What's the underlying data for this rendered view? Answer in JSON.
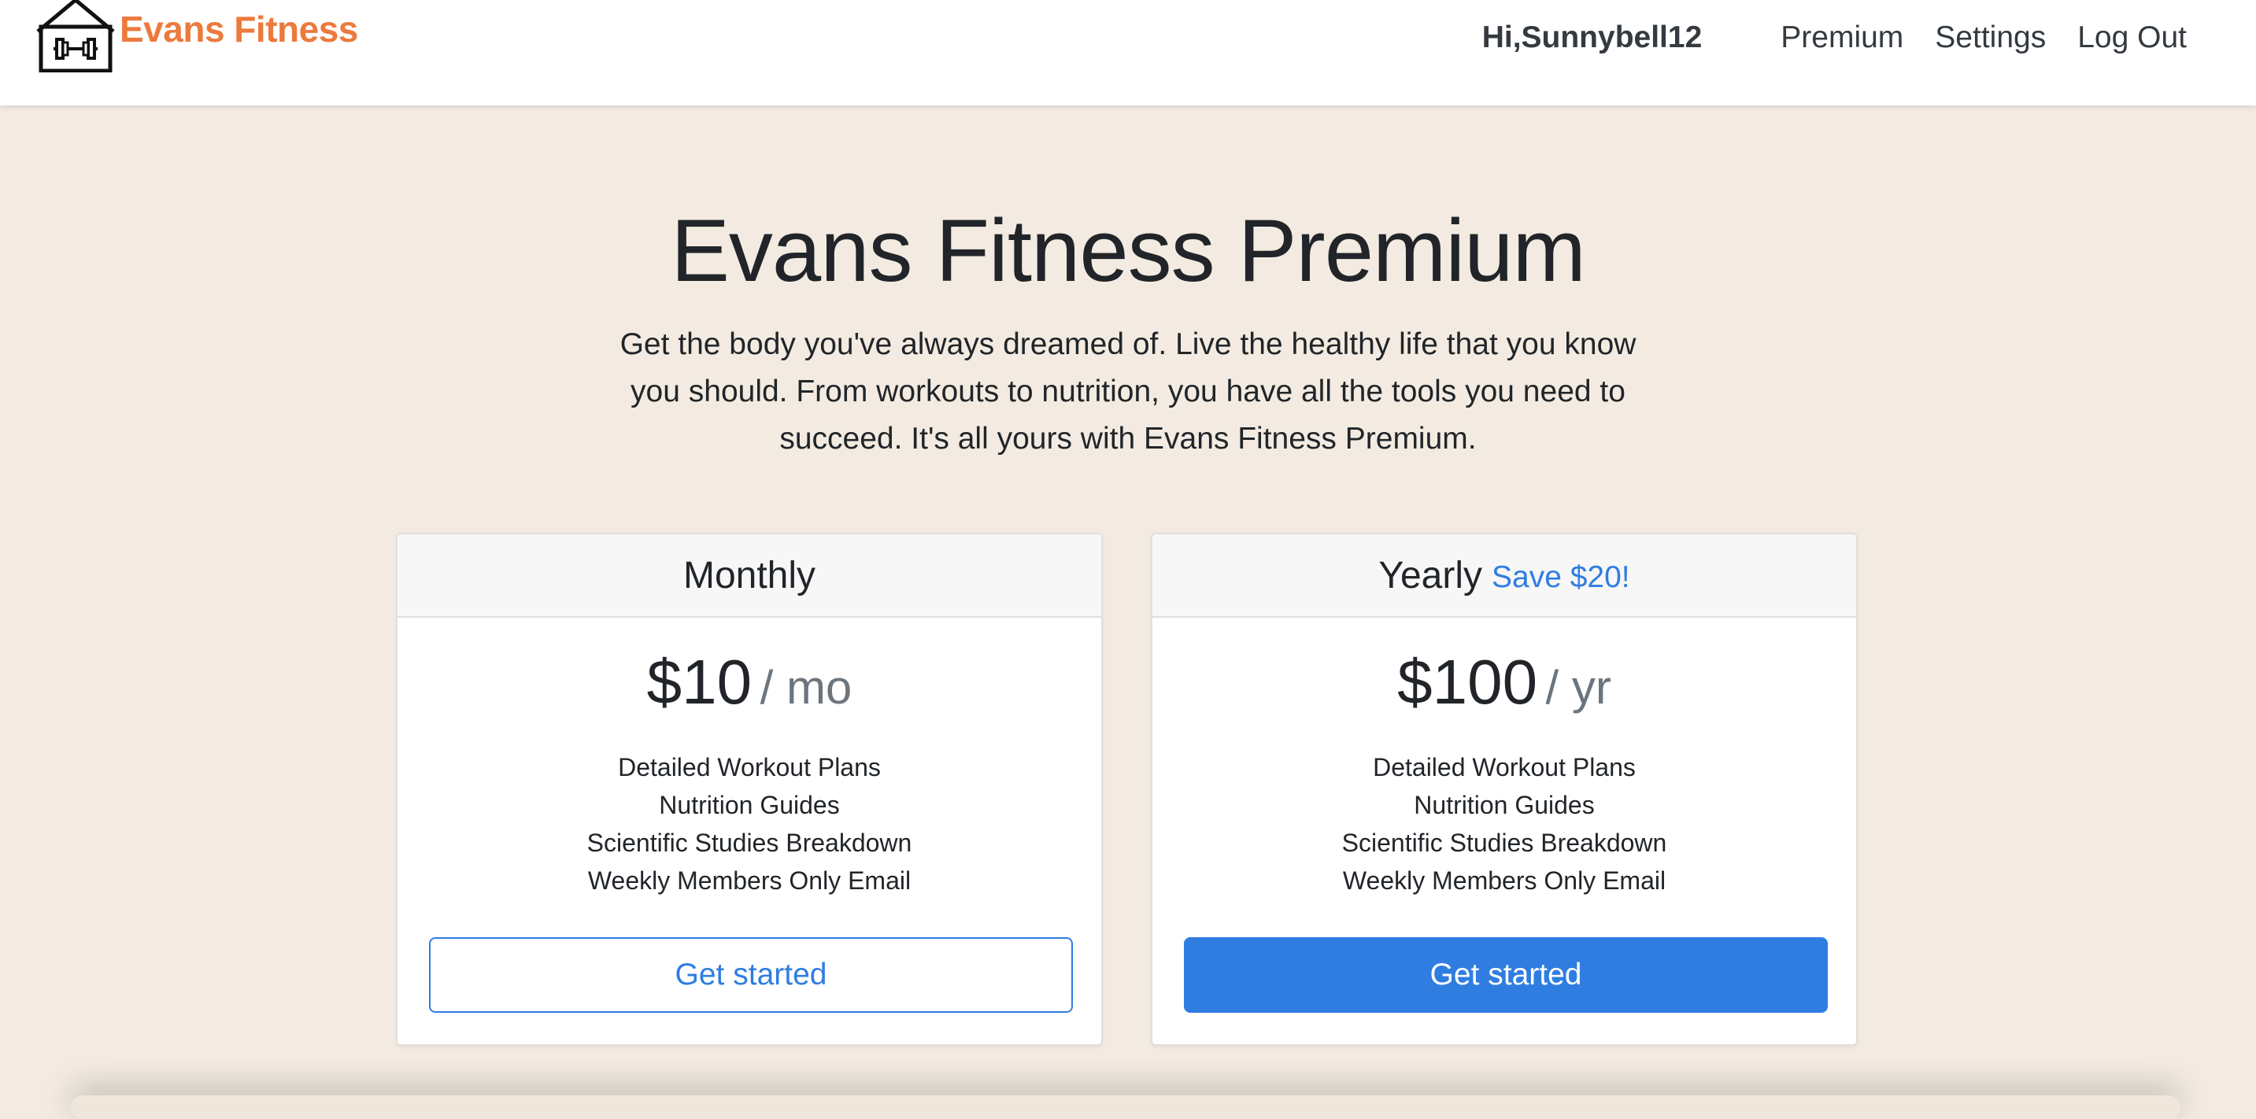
{
  "header": {
    "brand_name": "Evans Fitness",
    "logo_icon": "house-dumbbell-icon",
    "greeting": "Hi,Sunnybell12",
    "nav_items": [
      {
        "label": "Premium"
      },
      {
        "label": "Settings"
      },
      {
        "label": "Log Out"
      }
    ]
  },
  "hero": {
    "title": "Evans Fitness Premium",
    "description": "Get the body you've always dreamed of. Live the healthy life that you know you should. From workouts to nutrition, you have all the tools you need to succeed. It's all yours with Evans Fitness Premium."
  },
  "plans": [
    {
      "title": "Monthly",
      "badge": "",
      "price": "$10",
      "period": "/ mo",
      "features": [
        "Detailed Workout Plans",
        "Nutrition Guides",
        "Scientific Studies Breakdown",
        "Weekly Members Only Email"
      ],
      "button_label": "Get started",
      "button_style": "outline"
    },
    {
      "title": "Yearly",
      "badge": "Save $20!",
      "price": "$100",
      "period": "/ yr",
      "features": [
        "Detailed Workout Plans",
        "Nutrition Guides",
        "Scientific Studies Breakdown",
        "Weekly Members Only Email"
      ],
      "button_label": "Get started",
      "button_style": "primary"
    }
  ],
  "colors": {
    "brand": "#ec7a3d",
    "accent": "#2f7de1",
    "background": "#f3ebe1"
  }
}
